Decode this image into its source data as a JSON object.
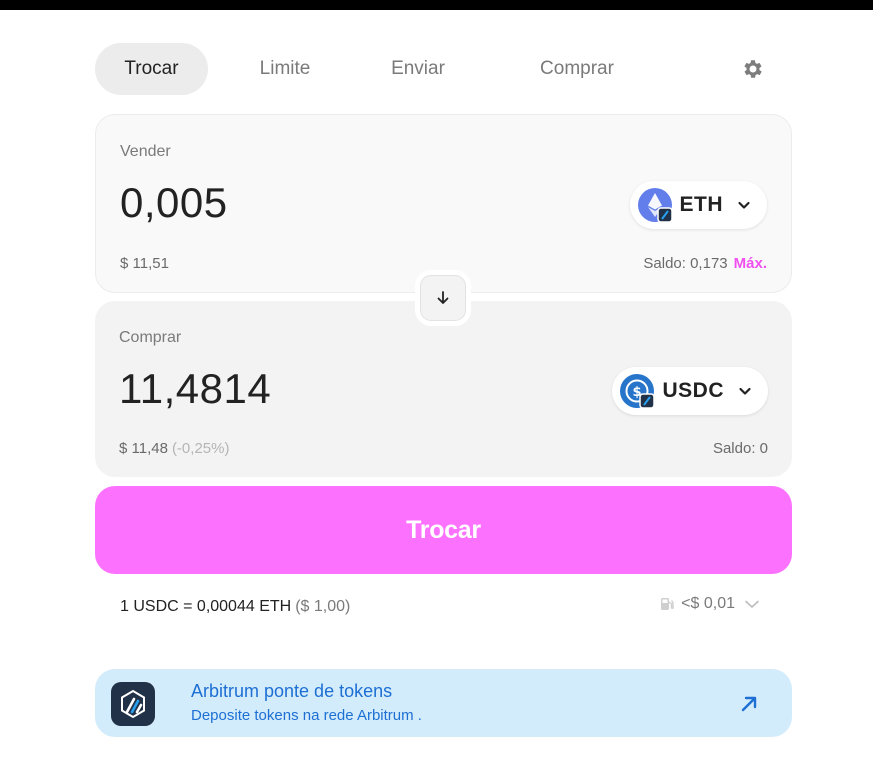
{
  "tabs": [
    {
      "label": "Trocar"
    },
    {
      "label": "Limite"
    },
    {
      "label": "Enviar"
    },
    {
      "label": "Comprar"
    }
  ],
  "sell": {
    "label": "Vender",
    "amount": "0,005",
    "usd_value": "$ 11,51",
    "token": "ETH",
    "balance": "Saldo: 0,173",
    "max_label": "Máx."
  },
  "buy": {
    "label": "Comprar",
    "amount": "11,4814",
    "usd_value": "$ 11,48",
    "price_impact": "(-0,25%)",
    "token": "USDC",
    "balance": "Saldo: 0"
  },
  "swap_button": "Trocar",
  "rate": {
    "text": "1 USDC = 0,00044 ETH",
    "usd": "($ 1,00)"
  },
  "gas": {
    "value": "<$ 0,01"
  },
  "banner": {
    "title": "Arbitrum ponte de tokens",
    "subtitle": "Deposite tokens na rede Arbitrum ."
  },
  "colors": {
    "accent": "#fc72ff",
    "max": "#f050f0",
    "banner_bg": "#d3ecfc",
    "banner_text": "#1d6fd3",
    "eth": "#627eea",
    "usdc": "#2775ca"
  },
  "icons": [
    "settings-gear-icon",
    "eth-token-icon",
    "usdc-token-icon",
    "arbitrum-network-badge-icon",
    "chevron-down-icon",
    "arrow-down-icon",
    "gas-pump-icon",
    "arbitrum-logo-icon",
    "arrow-up-right-icon"
  ]
}
